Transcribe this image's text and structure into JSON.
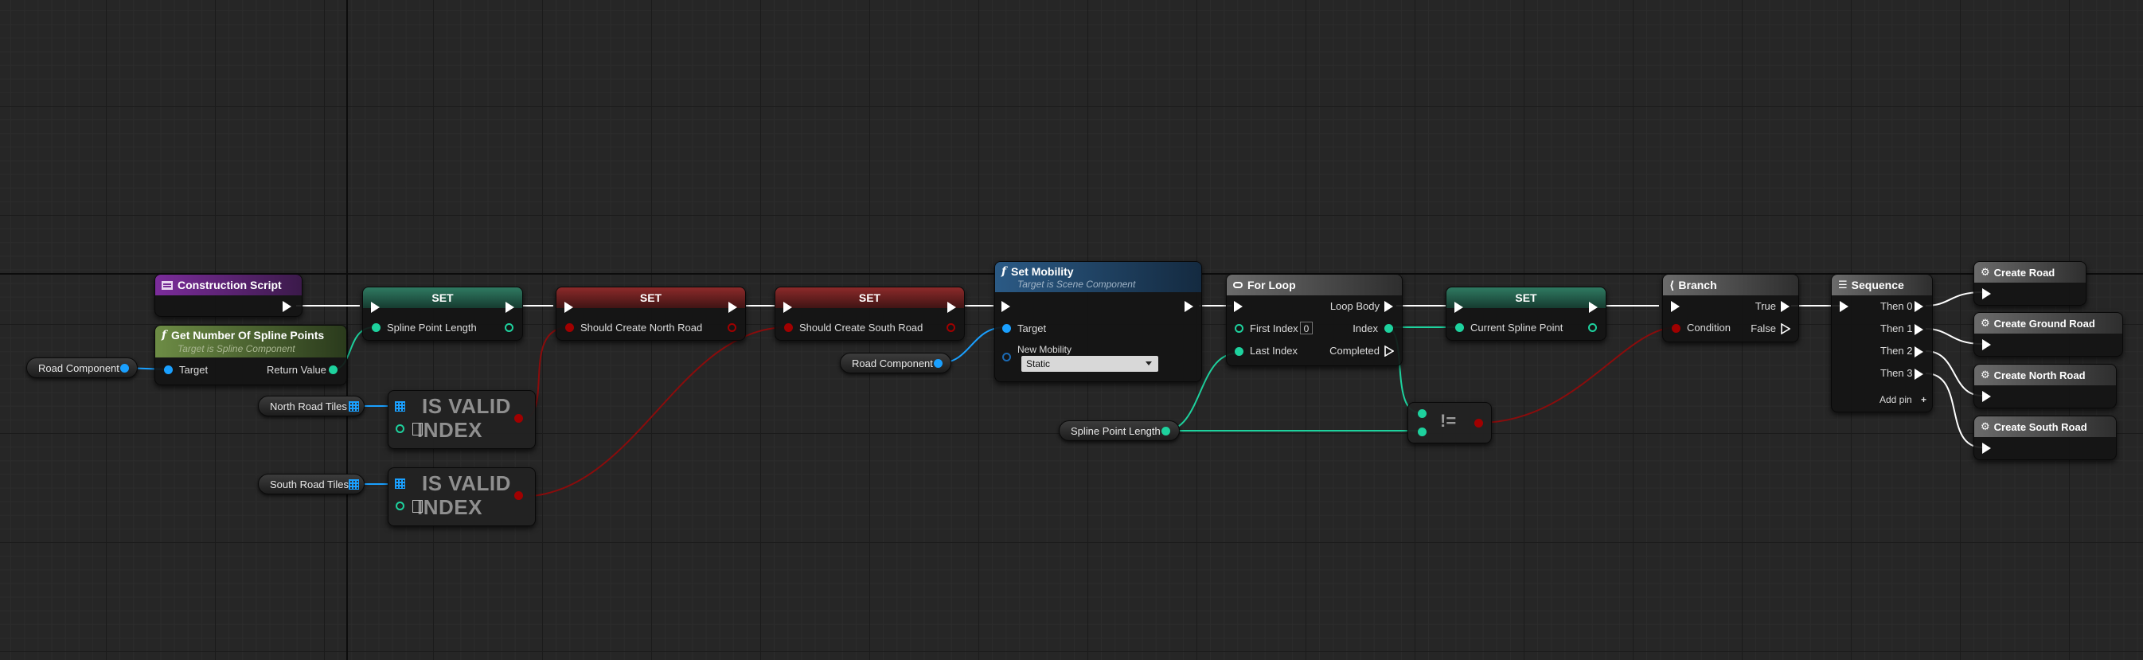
{
  "graph": {
    "background": "#262626"
  },
  "nodes": {
    "construction_script": {
      "title": "Construction Script",
      "icon": "construction-script-icon",
      "color": "#7b2c9b"
    },
    "get_num_spline": {
      "title": "Get Number Of Spline Points",
      "subtitle": "Target is Spline Component",
      "target": "Target",
      "return_value": "Return Value",
      "color": "#6d8c45"
    },
    "set1": {
      "title": "SET",
      "var": "Spline Point Length"
    },
    "set2": {
      "title": "SET",
      "var": "Should Create North Road"
    },
    "set3": {
      "title": "SET",
      "var": "Should Create South Road"
    },
    "is_valid_1": {
      "title_line1": "IS VALID",
      "title_line2": "INDEX"
    },
    "is_valid_2": {
      "title_line1": "IS VALID",
      "title_line2": "INDEX"
    },
    "set_mobility": {
      "title": "Set Mobility",
      "subtitle": "Target is Scene Component",
      "target": "Target",
      "new_mobility": "New Mobility",
      "mobility_value": "Static",
      "color": "#2b5a85"
    },
    "for_loop": {
      "title": "For Loop",
      "loop_body": "Loop Body",
      "first_index": "First Index",
      "first_index_value": "0",
      "index": "Index",
      "last_index": "Last Index",
      "completed": "Completed"
    },
    "set4": {
      "title": "SET",
      "var": "Current Spline Point"
    },
    "not_equal": {
      "symbol": "!="
    },
    "branch": {
      "title": "Branch",
      "condition": "Condition",
      "true_label": "True",
      "false_label": "False"
    },
    "sequence": {
      "title": "Sequence",
      "then0": "Then 0",
      "then1": "Then 1",
      "then2": "Then 2",
      "then3": "Then 3",
      "add_pin": "Add pin"
    },
    "create_road": {
      "title": "Create Road"
    },
    "create_ground_road": {
      "title": "Create Ground Road"
    },
    "create_north_road": {
      "title": "Create North Road"
    },
    "create_south_road": {
      "title": "Create South Road"
    }
  },
  "variables": {
    "road_component_1": "Road Component",
    "north_road_tiles": "North Road Tiles",
    "south_road_tiles": "South Road Tiles",
    "road_component_2": "Road Component",
    "spline_point_length": "Spline Point Length"
  },
  "colors": {
    "exec": "#ffffff",
    "object": "#1aa0ff",
    "integer": "#1ed29e",
    "boolean": "#a00000",
    "struct": "#1a6ab5"
  }
}
